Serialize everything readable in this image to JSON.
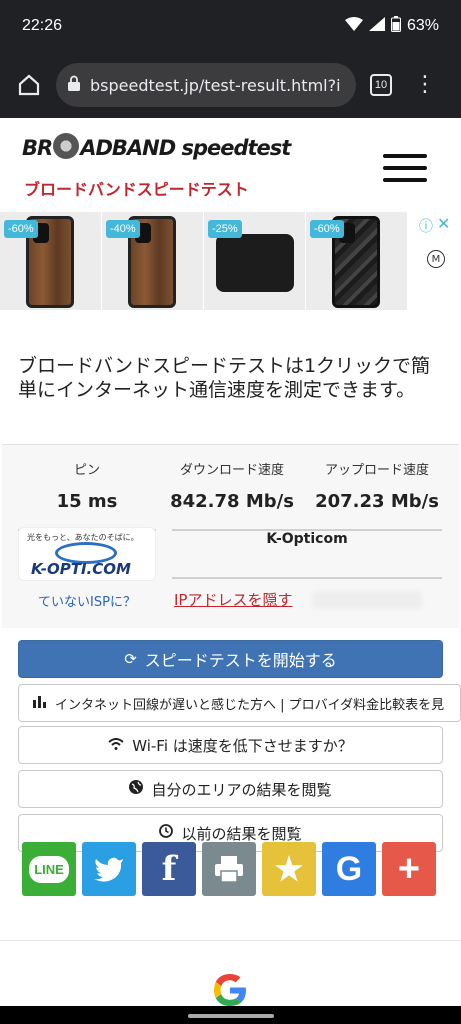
{
  "status_bar": {
    "time": "22:26",
    "battery": "63%"
  },
  "browser": {
    "url": "bspeedtest.jp/test-result.html?i",
    "tab_count": "10"
  },
  "site": {
    "logo_left": "BR",
    "logo_right": "ADBAND speedtest",
    "logo_sub": "ブロードバンドスピードテスト"
  },
  "ads": [
    {
      "discount": "-60%",
      "kind": "wood"
    },
    {
      "discount": "-40%",
      "kind": "wood"
    },
    {
      "discount": "-25%",
      "kind": "pouch"
    },
    {
      "discount": "-60%",
      "kind": "camo"
    }
  ],
  "intro": "ブロードバンドスピードテストは1クリックで簡単にインターネット通信速度を測定できます。",
  "results": {
    "ping_label": "ピン",
    "download_label": "ダウンロード速度",
    "upload_label": "アップロード速度",
    "ping_value": "15 ms",
    "download_value": "842.78 Mb/s",
    "upload_value": "207.23 Mb/s",
    "isp_name": "K-Opticom",
    "isp_logo_tagline": "光をもっと、あなたのそばに。",
    "isp_logo_text": "K-OPTI.COM",
    "not_isp_link": "ていないISPに？",
    "ip_hide_link": "IPアドレスを隠す"
  },
  "buttons": {
    "start": "スピードテストを開始する",
    "compare": "インタネット回線が遅いと感じた方へ | プロバイダ料金比較表を見",
    "wifi": "Wi-Fi は速度を低下させますか？",
    "area": "自分のエリアの結果を閲覧",
    "previous": "以前の結果を閲覧"
  },
  "share": [
    {
      "name": "line",
      "label": "LINE",
      "color": "#3aae36"
    },
    {
      "name": "twitter",
      "label": "",
      "color": "#2a9fe3"
    },
    {
      "name": "facebook",
      "label": "f",
      "color": "#3b5a9a"
    },
    {
      "name": "print",
      "label": "",
      "color": "#7b8a8f"
    },
    {
      "name": "favorite",
      "label": "★",
      "color": "#e6c23b"
    },
    {
      "name": "google",
      "label": "G",
      "color": "#2f7de1"
    },
    {
      "name": "more",
      "label": "+",
      "color": "#e5584a"
    }
  ]
}
